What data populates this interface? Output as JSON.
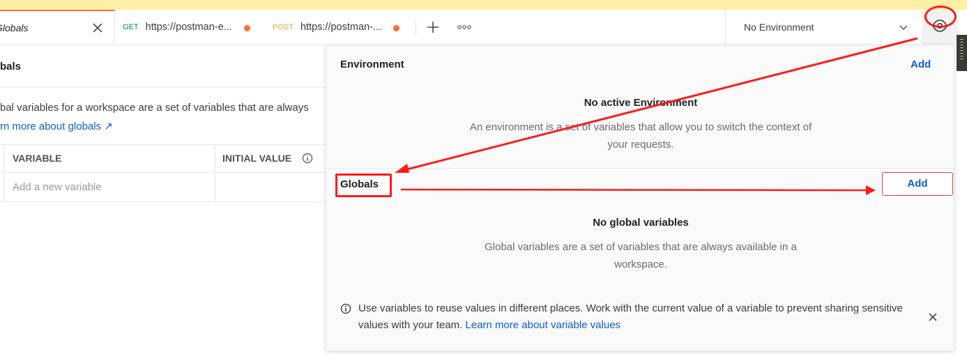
{
  "tabs": {
    "active": {
      "label": "Globals"
    },
    "get": {
      "method": "GET",
      "url": "https://postman-e..."
    },
    "post": {
      "method": "POST",
      "url": "https://postman-..."
    }
  },
  "environment_selector": {
    "value": "No Environment"
  },
  "globals_page": {
    "title": "bals",
    "description": "bal variables for a workspace are a set of variables that are always",
    "learn_more": "rn more about globals ↗",
    "columns": [
      "VARIABLE",
      "INITIAL VALUE"
    ],
    "new_variable_placeholder": "Add a new variable"
  },
  "popover": {
    "environment": {
      "heading": "Environment",
      "add_label": "Add",
      "empty_title": "No active Environment",
      "empty_desc": "An environment is a set of variables that allow you to switch the context of your requests."
    },
    "globals": {
      "heading": "Globals",
      "add_label": "Add",
      "empty_title": "No global variables",
      "empty_desc": "Global variables are a set of variables that are always available in a workspace."
    },
    "tip": {
      "text": "Use variables to reuse values in different places. Work with the current value of a variable to prevent sharing sensitive values with your team.",
      "link": "Learn more about variable values"
    }
  },
  "colors": {
    "accent": "#ff6c37",
    "link": "#0b5ed7",
    "annotation": "#ff1a1a",
    "banner": "#fdf0a6"
  }
}
